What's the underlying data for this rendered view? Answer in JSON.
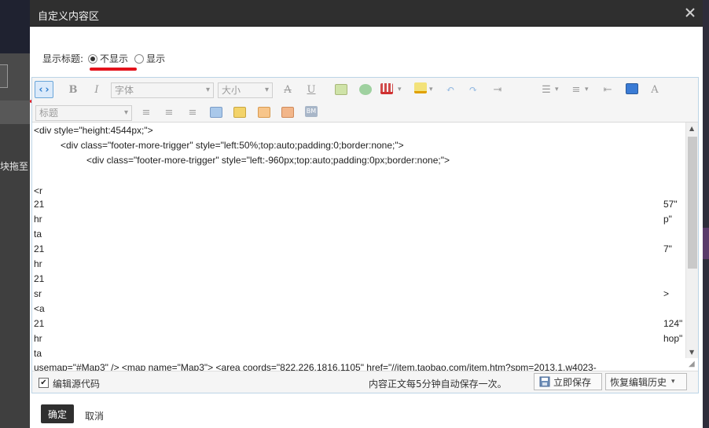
{
  "background": {
    "left_text": "块拖至"
  },
  "dialog": {
    "title": "自定义内容区",
    "close_icon": "close-icon"
  },
  "title_setting": {
    "label": "显示标题:",
    "options": [
      "不显示",
      "显示"
    ],
    "selected": "不显示"
  },
  "toolbar": {
    "font_select": "字体",
    "size_select": "大小",
    "heading_select": "标题",
    "icons": [
      "source-code-icon",
      "bold-icon",
      "italic-icon",
      "strikethrough-icon",
      "underline-icon",
      "image-icon",
      "emoticon-icon",
      "table-icon",
      "fill-color-icon",
      "undo-icon",
      "redo-icon",
      "indent-icon",
      "unordered-list-icon",
      "ordered-list-icon",
      "horizontal-rule-icon",
      "preview-icon",
      "clear-format-icon",
      "align-left-icon",
      "align-center-icon",
      "align-right-icon",
      "layout-icon",
      "glasses-icon",
      "frame-icon",
      "module-icon",
      "bm-icon"
    ],
    "bm_label": "BM"
  },
  "code": {
    "lines": [
      "<div style=\"height:4544px;\">",
      "<div class=\"footer-more-trigger\" style=\"left:50%;top:auto;padding:0;border:none;\">",
      "<div class=\"footer-more-trigger\" style=\"left:-960px;top:auto;padding:0px;border:none;\">",
      "<r",
      "21",
      "hr",
      "ta",
      "21",
      "hr",
      "21",
      "sr",
      "<a",
      "21",
      "hr",
      "ta",
      "usemap=\"#Map3\" />  <map name=\"Map3\">  <area coords=\"822,226,1816,1105\" href=\"//item.taobao.com/item.htm?spm=2013.1.w4023-"
    ],
    "right_fragments": [
      "57\"",
      "p\"",
      "7\"",
      ">",
      "124\"",
      "hop\""
    ]
  },
  "footer": {
    "edit_source_label": "编辑源代码",
    "edit_source_checked": true,
    "autosave_text": "内容正文每5分钟自动保存一次。",
    "save_label": "立即保存",
    "restore_label": "恢复编辑历史"
  },
  "actions": {
    "ok_label": "确定",
    "cancel_label": "取消"
  },
  "colors": {
    "header": "#2f2f2f",
    "highlight": "#e4121b",
    "source_button": "#dbeafa"
  }
}
